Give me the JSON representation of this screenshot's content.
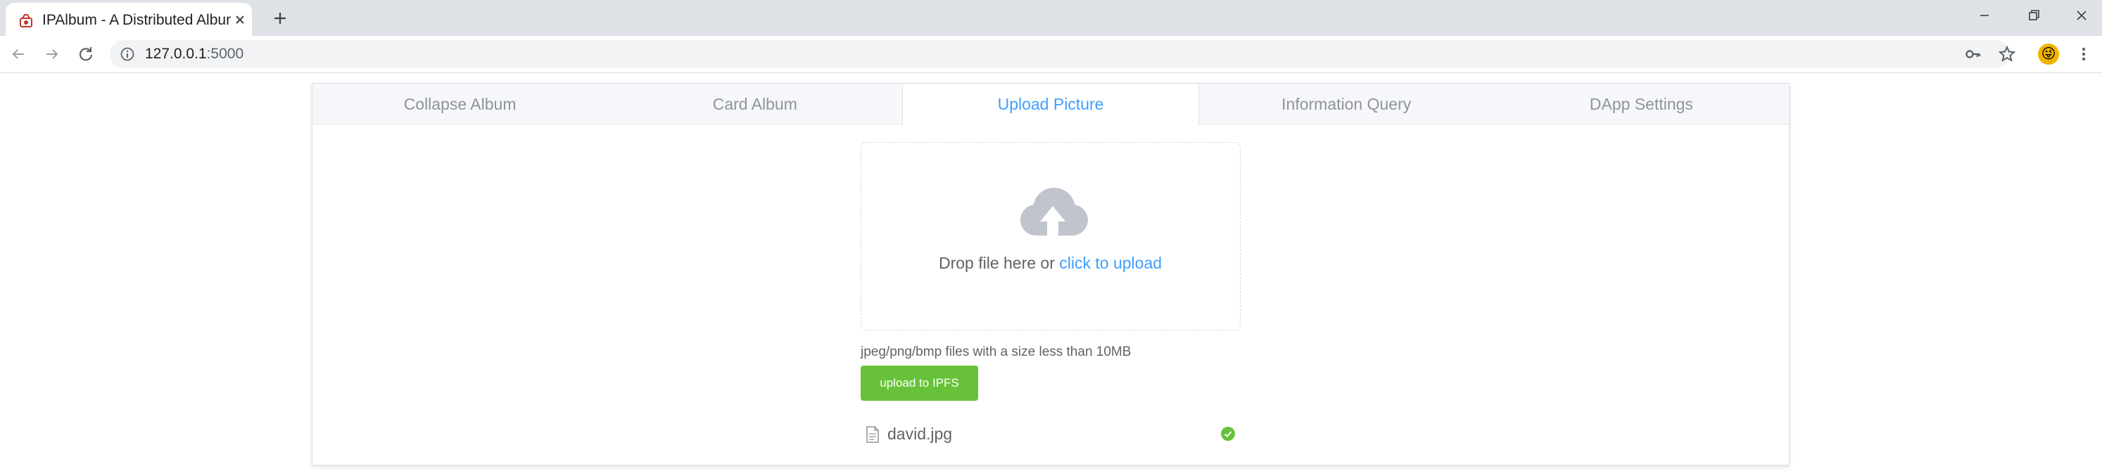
{
  "browser": {
    "tab_title": "IPAlbum - A Distributed Album",
    "url_host": "127.0.0.1",
    "url_port": ":5000",
    "accent_color": "#409eff"
  },
  "app": {
    "tabs": [
      {
        "label": "Collapse Album",
        "active": false
      },
      {
        "label": "Card Album",
        "active": false
      },
      {
        "label": "Upload Picture",
        "active": true
      },
      {
        "label": "Information Query",
        "active": false
      },
      {
        "label": "DApp Settings",
        "active": false
      }
    ],
    "upload": {
      "drop_text": "Drop file here or ",
      "click_text": "click to upload",
      "tip": "jpeg/png/bmp files with a size less than 10MB",
      "button_label": "upload to IPFS",
      "button_color": "#67c23a",
      "files": [
        {
          "name": "david.jpg",
          "status": "success"
        }
      ]
    }
  }
}
